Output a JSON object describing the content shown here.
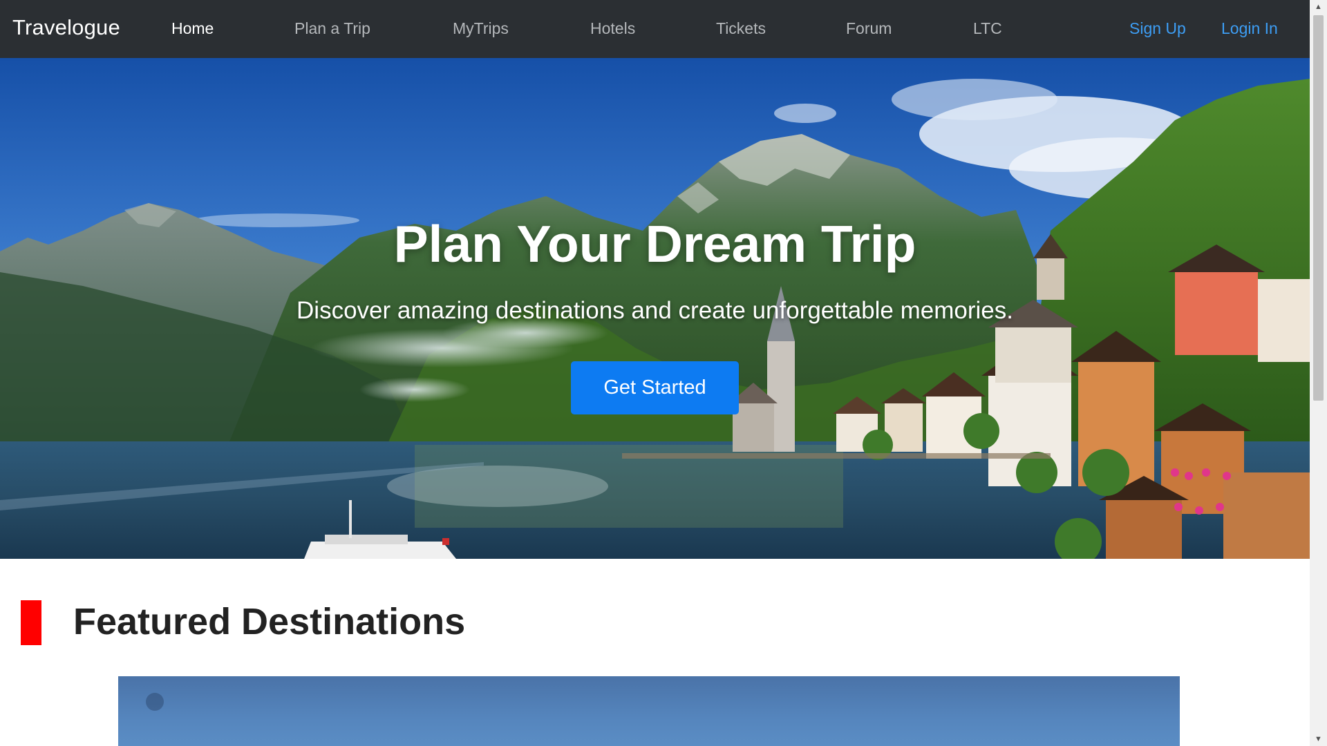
{
  "navbar": {
    "brand": "Travelogue",
    "links": [
      {
        "label": "Home",
        "active": true
      },
      {
        "label": "Plan a Trip",
        "active": false
      },
      {
        "label": "MyTrips",
        "active": false
      },
      {
        "label": "Hotels",
        "active": false
      },
      {
        "label": "Tickets",
        "active": false
      },
      {
        "label": "Forum",
        "active": false
      },
      {
        "label": "LTC",
        "active": false
      }
    ],
    "auth": {
      "signup": "Sign Up",
      "login": "Login In"
    }
  },
  "hero": {
    "title": "Plan Your Dream Trip",
    "subtitle": "Discover amazing destinations and create unforgettable memories.",
    "cta": "Get Started"
  },
  "featured": {
    "title": "Featured Destinations"
  },
  "colors": {
    "navbar_bg": "#2b2f33",
    "nav_link": "#b5b8bb",
    "nav_active": "#ffffff",
    "auth_link": "#3d9ef5",
    "cta_bg": "#0d7bf2",
    "section_marker": "#ff0000",
    "heading": "#222222"
  },
  "icons": {
    "scroll_up": "scroll-up-arrow-icon",
    "scroll_down": "scroll-down-arrow-icon"
  }
}
